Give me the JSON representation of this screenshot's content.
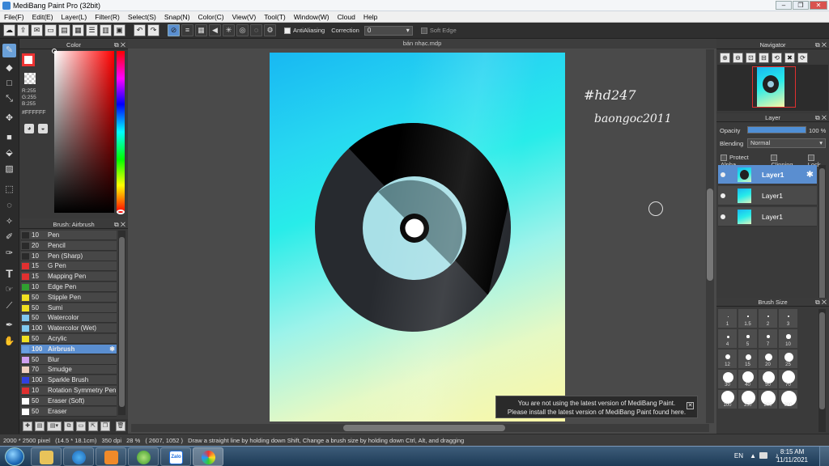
{
  "window": {
    "title": "MediBang Paint Pro (32bit)"
  },
  "menu": [
    "File(F)",
    "Edit(E)",
    "Layer(L)",
    "Filter(R)",
    "Select(S)",
    "Snap(N)",
    "Color(C)",
    "View(V)",
    "Tool(T)",
    "Window(W)",
    "Cloud",
    "Help"
  ],
  "toolbar": {
    "antialiasing_label": "AntiAliasing",
    "correction_label": "Correction",
    "correction_value": "0",
    "soft_edge_label": "Soft Edge"
  },
  "color_panel": {
    "title": "Color",
    "r": "R:255",
    "g": "G:255",
    "b": "B:255",
    "hex": "#FFFFFF"
  },
  "brush_panel": {
    "title": "Brush: Airbrush",
    "items": [
      {
        "size": "10",
        "name": "Pen",
        "color": "#2a2a2a"
      },
      {
        "size": "20",
        "name": "Pencil",
        "color": "#2a2a2a"
      },
      {
        "size": "10",
        "name": "Pen (Sharp)",
        "color": "#2a2a2a"
      },
      {
        "size": "15",
        "name": "G Pen",
        "color": "#e03030"
      },
      {
        "size": "15",
        "name": "Mapping Pen",
        "color": "#e03030"
      },
      {
        "size": "10",
        "name": "Edge Pen",
        "color": "#30a030"
      },
      {
        "size": "50",
        "name": "Stipple Pen",
        "color": "#f0e020"
      },
      {
        "size": "50",
        "name": "Sumi",
        "color": "#f0e020"
      },
      {
        "size": "50",
        "name": "Watercolor",
        "color": "#80c8f0"
      },
      {
        "size": "100",
        "name": "Watercolor (Wet)",
        "color": "#80c8f0"
      },
      {
        "size": "50",
        "name": "Acrylic",
        "color": "#f0e020"
      },
      {
        "size": "100",
        "name": "Airbrush",
        "color": "#6aa0e0"
      },
      {
        "size": "50",
        "name": "Blur",
        "color": "#d0a0f0"
      },
      {
        "size": "70",
        "name": "Smudge",
        "color": "#f0d0c0"
      },
      {
        "size": "100",
        "name": "Sparkle Brush",
        "color": "#3040e0"
      },
      {
        "size": "10",
        "name": "Rotation Symmetry Pen",
        "color": "#e03030"
      },
      {
        "size": "50",
        "name": "Eraser (Soft)",
        "color": "#ffffff"
      },
      {
        "size": "50",
        "name": "Eraser",
        "color": "#ffffff"
      }
    ]
  },
  "canvas": {
    "document_tab": "bán nhạc.mdp",
    "text1": "#hd247",
    "text2": "baongoc2011"
  },
  "notice": {
    "line1": "You are not using the latest version of MediBang Paint.",
    "line2": "Please install the latest version of MediBang Paint found here."
  },
  "navigator": {
    "title": "Navigator"
  },
  "layer_panel": {
    "title": "Layer",
    "opacity_label": "Opacity",
    "opacity_value": "100 %",
    "opacity_percent": 100,
    "blending_label": "Blending",
    "blending_value": "Normal",
    "protect_alpha": "Protect Alpha",
    "clipping": "Clipping",
    "lock": "Lock",
    "layers": [
      "Layer1",
      "Layer1",
      "Layer1"
    ]
  },
  "brush_size": {
    "title": "Brush Size",
    "values": [
      "1",
      "1.5",
      "2",
      "3",
      "4",
      "5",
      "7",
      "10",
      "12",
      "15",
      "20",
      "25",
      "30",
      "40",
      "50",
      "70",
      "100",
      "150",
      "200",
      "300"
    ]
  },
  "status": {
    "dimensions": "2000 * 2500 pixel",
    "physical": "(14.5 * 18.1cm)",
    "dpi": "350 dpi",
    "zoom": "28 %",
    "coords": "( 2607, 1052 )",
    "hint": "Draw a straight line by holding down Shift, Change a brush size by holding down Ctrl, Alt, and dragging"
  },
  "taskbar": {
    "lang": "EN",
    "time": "8:15 AM",
    "date": "11/11/2021",
    "zalo_label": "Zalo"
  }
}
